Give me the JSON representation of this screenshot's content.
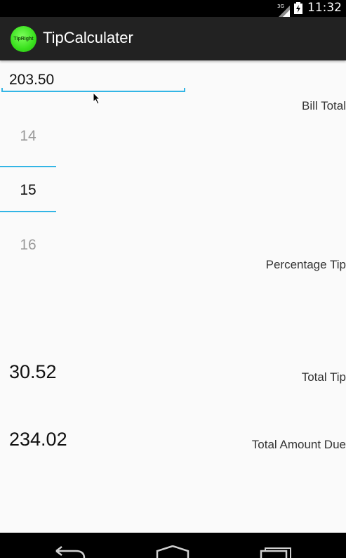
{
  "status_bar": {
    "network": "3G",
    "time": "11:32"
  },
  "app": {
    "icon_text": "TipRight",
    "title": "TipCalculater"
  },
  "bill": {
    "value": "203.50",
    "label": "Bill Total"
  },
  "percentage": {
    "options": [
      "14",
      "15",
      "16"
    ],
    "selected": "15",
    "label": "Percentage Tip"
  },
  "tip": {
    "value": "30.52",
    "label": "Total Tip"
  },
  "total": {
    "value": "234.02",
    "label": "Total Amount Due"
  },
  "colors": {
    "accent": "#33b5e5",
    "action_bar": "#222222",
    "background": "#fafafa",
    "icon_green": "#38e01c"
  },
  "nav_bar": {
    "icons": [
      "back-icon",
      "home-icon",
      "recent-apps-icon"
    ]
  }
}
